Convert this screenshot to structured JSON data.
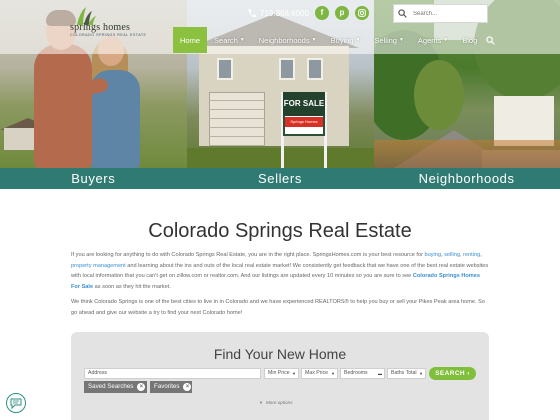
{
  "brand": {
    "name": "springs homes",
    "tagline": "COLORADO SPRINGS REAL ESTATE"
  },
  "header": {
    "phone": "719.368.6000",
    "search_placeholder": "Search..."
  },
  "nav": {
    "items": [
      {
        "label": "Home",
        "active": true,
        "has_dropdown": false
      },
      {
        "label": "Search",
        "active": false,
        "has_dropdown": true
      },
      {
        "label": "Neighborhoods",
        "active": false,
        "has_dropdown": true
      },
      {
        "label": "Buying",
        "active": false,
        "has_dropdown": true
      },
      {
        "label": "Selling",
        "active": false,
        "has_dropdown": true
      },
      {
        "label": "Agents",
        "active": false,
        "has_dropdown": true
      },
      {
        "label": "Blog",
        "active": false,
        "has_dropdown": false
      }
    ]
  },
  "hero": {
    "panels": [
      {
        "label": "Buyers"
      },
      {
        "label": "Sellers"
      },
      {
        "label": "Neighborhoods"
      }
    ],
    "sign_text": "FOR SALE",
    "sign_brand": "Springs Homes"
  },
  "content": {
    "title": "Colorado Springs Real Estate",
    "p1_start": "If you are looking for anything to do with Colorado Springs Real Estate, you are in the right place. SpringsHomes.com is your best resource for ",
    "link_buying": "buying",
    "sep1": ", ",
    "link_selling": "selling",
    "sep2": ", ",
    "link_renting": "renting",
    "sep3": ", ",
    "link_pm": "property management",
    "p1_mid": " and learning about the ins and outs of the local real estate market! We consistently get feedback that we have one of the best real estate websites with local information that you can't get on zillow.com or realtor.com. And our listings are updated every 10 minutes so you are sure to see ",
    "link_fsale": "Colorado Springs Homes For Sale",
    "p1_end": " as soon as they hit the market.",
    "p2": "We think Colorado Springs is one of the best cities to live in in Colorado and we have experienced REALTORS® to help you buy or sell your Pikes Peak area home. So go ahead and give our website a try to find your next Colorado home!"
  },
  "finder": {
    "title": "Find Your New Home",
    "address_placeholder": "Address",
    "min_price": "Min Price",
    "max_price": "Max Price",
    "bedrooms": "Bedrooms",
    "baths": "Baths Total",
    "search_label": "SEARCH",
    "saved_searches": "Saved Searches",
    "favorites": "Favorites",
    "more_options": "More options"
  },
  "colors": {
    "accent_green": "#8cc13f",
    "teal": "#2f7b73",
    "link": "#3a8fd1"
  },
  "icons": [
    "phone-icon",
    "facebook-icon",
    "pinterest-icon",
    "instagram-icon",
    "search-icon",
    "chevron-down-icon",
    "close-icon",
    "chat-icon"
  ]
}
